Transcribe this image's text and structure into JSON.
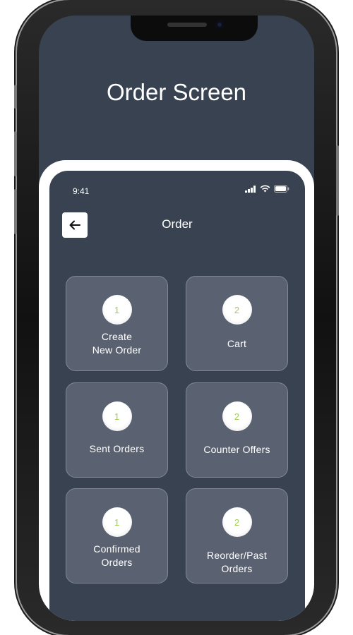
{
  "page": {
    "title": "Order Screen"
  },
  "status_bar": {
    "time": "9:41",
    "icons": [
      "signal-icon",
      "wifi-icon",
      "battery-icon"
    ]
  },
  "header": {
    "title": "Order",
    "back_icon": "arrow-left-icon"
  },
  "cards": [
    {
      "badge": "1",
      "label": "Create\nNew Order"
    },
    {
      "badge": "2",
      "label": "Cart"
    },
    {
      "badge": "1",
      "label": "Sent Orders"
    },
    {
      "badge": "2",
      "label": "Counter Offers"
    },
    {
      "badge": "1",
      "label": "Confirmed\nOrders"
    },
    {
      "badge": "2",
      "label": "Reorder/Past\nOrders"
    }
  ],
  "colors": {
    "background": "#384251",
    "card": "#5a6271",
    "badge_text": "#9fd04b"
  }
}
